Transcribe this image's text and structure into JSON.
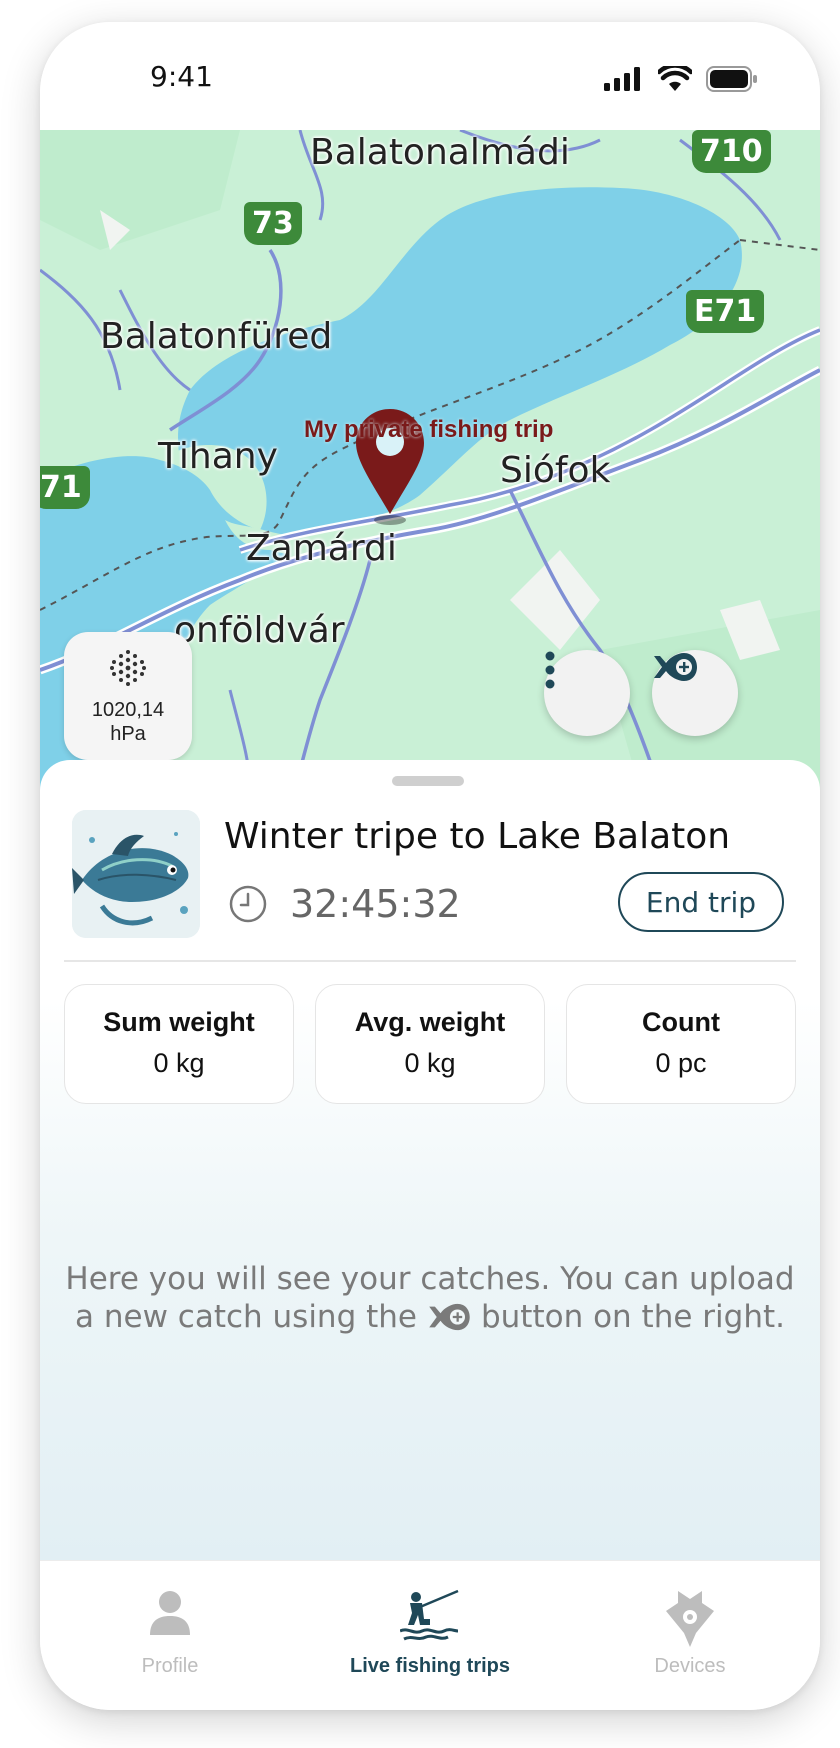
{
  "status_bar": {
    "time": "9:41"
  },
  "map": {
    "labels": {
      "balatonalmadi": "Balatonalmádi",
      "balatonfured": "Balatonfüred",
      "tihany": "Tihany",
      "siofok": "Siófok",
      "zamardi": "Zamárdi",
      "balatonfoldvar": "onföldvár"
    },
    "route_shields": {
      "r73": "73",
      "r710": "710",
      "e71": "E71",
      "r71": "71"
    },
    "pin_label": "My private fishing trip",
    "pressure": {
      "value": "1020,14",
      "unit": "hPa"
    }
  },
  "trip": {
    "title": "Winter tripe to Lake Balaton",
    "elapsed": "32:45:32",
    "end_button": "End trip"
  },
  "stats": [
    {
      "label": "Sum weight",
      "value": "0 kg"
    },
    {
      "label": "Avg. weight",
      "value": "0 kg"
    },
    {
      "label": "Count",
      "value": "0 pc"
    }
  ],
  "empty_state": {
    "line1": "Here you will see your catches. You can upload",
    "line2_before": "a new catch using the",
    "line2_after": "button on the right."
  },
  "tabs": [
    {
      "label": "Profile",
      "icon": "person-icon",
      "active": false
    },
    {
      "label": "Live fishing trips",
      "icon": "angler-icon",
      "active": true
    },
    {
      "label": "Devices",
      "icon": "device-icon",
      "active": false
    }
  ],
  "colors": {
    "water": "#7fd0e8",
    "land": "#c9f0d6",
    "pin": "#7a1a1a",
    "accent": "#1f4858",
    "inactive_tab": "#bdbdbd"
  }
}
